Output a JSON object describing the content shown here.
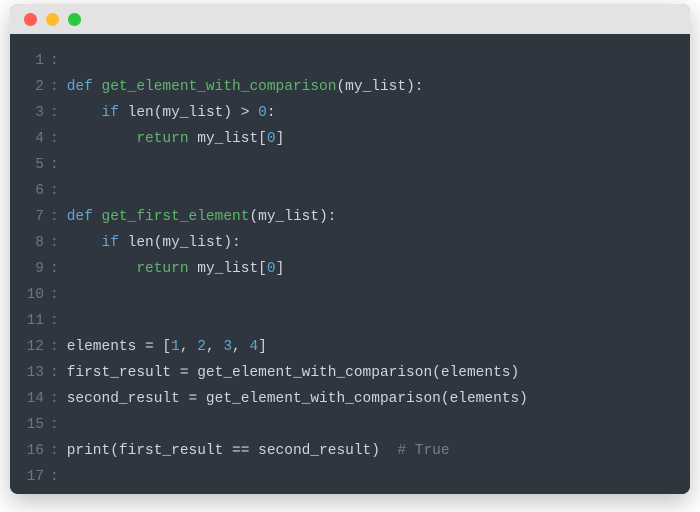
{
  "titlebar": {
    "close": "close",
    "minimize": "minimize",
    "maximize": "maximize"
  },
  "gutter_sep": ":",
  "lines": [
    {
      "n": "1",
      "tokens": []
    },
    {
      "n": "2",
      "tokens": [
        {
          "t": "def ",
          "c": "tok-kw"
        },
        {
          "t": "get_element_with_comparison",
          "c": "tok-fn"
        },
        {
          "t": "(my_list):",
          "c": "tok-punct"
        }
      ]
    },
    {
      "n": "3",
      "tokens": [
        {
          "t": "    ",
          "c": "tok-ident"
        },
        {
          "t": "if ",
          "c": "tok-kw"
        },
        {
          "t": "len(my_list) > ",
          "c": "tok-ident"
        },
        {
          "t": "0",
          "c": "tok-num"
        },
        {
          "t": ":",
          "c": "tok-punct"
        }
      ]
    },
    {
      "n": "4",
      "tokens": [
        {
          "t": "        ",
          "c": "tok-ident"
        },
        {
          "t": "return ",
          "c": "tok-fn"
        },
        {
          "t": "my_list[",
          "c": "tok-ident"
        },
        {
          "t": "0",
          "c": "tok-num"
        },
        {
          "t": "]",
          "c": "tok-punct"
        }
      ]
    },
    {
      "n": "5",
      "tokens": []
    },
    {
      "n": "6",
      "tokens": []
    },
    {
      "n": "7",
      "tokens": [
        {
          "t": "def ",
          "c": "tok-kw"
        },
        {
          "t": "get_first_element",
          "c": "tok-fn"
        },
        {
          "t": "(my_list):",
          "c": "tok-punct"
        }
      ]
    },
    {
      "n": "8",
      "tokens": [
        {
          "t": "    ",
          "c": "tok-ident"
        },
        {
          "t": "if ",
          "c": "tok-kw"
        },
        {
          "t": "len(my_list):",
          "c": "tok-ident"
        }
      ]
    },
    {
      "n": "9",
      "tokens": [
        {
          "t": "        ",
          "c": "tok-ident"
        },
        {
          "t": "return ",
          "c": "tok-fn"
        },
        {
          "t": "my_list[",
          "c": "tok-ident"
        },
        {
          "t": "0",
          "c": "tok-num"
        },
        {
          "t": "]",
          "c": "tok-punct"
        }
      ]
    },
    {
      "n": "10",
      "tokens": []
    },
    {
      "n": "11",
      "tokens": []
    },
    {
      "n": "12",
      "tokens": [
        {
          "t": "elements = [",
          "c": "tok-ident"
        },
        {
          "t": "1",
          "c": "tok-num"
        },
        {
          "t": ", ",
          "c": "tok-punct"
        },
        {
          "t": "2",
          "c": "tok-num"
        },
        {
          "t": ", ",
          "c": "tok-punct"
        },
        {
          "t": "3",
          "c": "tok-num"
        },
        {
          "t": ", ",
          "c": "tok-punct"
        },
        {
          "t": "4",
          "c": "tok-num"
        },
        {
          "t": "]",
          "c": "tok-punct"
        }
      ]
    },
    {
      "n": "13",
      "tokens": [
        {
          "t": "first_result = get_element_with_comparison(elements)",
          "c": "tok-ident"
        }
      ]
    },
    {
      "n": "14",
      "tokens": [
        {
          "t": "second_result = get_element_with_comparison(elements)",
          "c": "tok-ident"
        }
      ]
    },
    {
      "n": "15",
      "tokens": []
    },
    {
      "n": "16",
      "tokens": [
        {
          "t": "print(first_result == second_result)  ",
          "c": "tok-ident"
        },
        {
          "t": "# True",
          "c": "tok-comment"
        }
      ]
    },
    {
      "n": "17",
      "tokens": []
    }
  ]
}
